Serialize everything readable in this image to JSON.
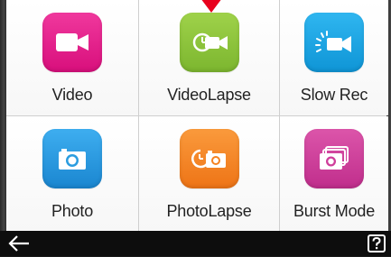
{
  "modes": [
    {
      "label": "Video",
      "color": "#e8168a",
      "icon": "video-camera-icon"
    },
    {
      "label": "VideoLapse",
      "color": "#8cc63f",
      "icon": "videolapse-icon"
    },
    {
      "label": "Slow Rec",
      "color": "#1aa6e4",
      "icon": "slow-rec-icon"
    },
    {
      "label": "Photo",
      "color": "#2b9de0",
      "icon": "photo-camera-icon"
    },
    {
      "label": "PhotoLapse",
      "color": "#f58220",
      "icon": "photolapse-icon"
    },
    {
      "label": "Burst Mode",
      "color": "#cf3e9b",
      "icon": "burst-mode-icon"
    }
  ],
  "selected_mode": "VideoLapse",
  "bottombar": {
    "back_icon": "back-arrow-icon",
    "help_icon": "help-icon"
  }
}
